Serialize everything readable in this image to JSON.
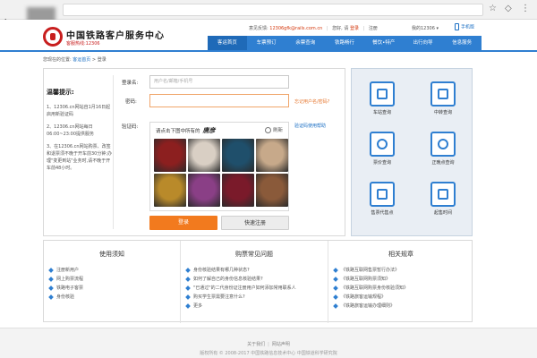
{
  "site": {
    "title": "中国铁路客户服务中心",
    "hotline": "客服热线:12306"
  },
  "toplinks": {
    "email": "12306gfk@rails.com.cn",
    "login_prompt": "您好, 请",
    "login": "登录",
    "register": "注册",
    "user_menu": "我的12306 ▾",
    "mobile": "手机版"
  },
  "nav": {
    "items": [
      "客运首页",
      "车票预订",
      "余票查询",
      "铁路畅行",
      "餐饮•特产",
      "出行向导",
      "信息服务"
    ]
  },
  "breadcrumb": {
    "prefix": "您现在的位置:",
    "home": "客运首页",
    "sep": ">",
    "current": "登录"
  },
  "tips": {
    "title": "温馨提示:",
    "items": [
      "1、12306.cn网站自1月16日起启用新验证码",
      "2、12306.cn网站每日06:00~23:00提供服务",
      "3、在12306.cn网站购票、改签和退票须不晚于开车前30分钟;办理\"变更到站\"业务时,请不晚于开车前48小时。"
    ]
  },
  "login_form": {
    "username_label": "登录名:",
    "username_placeholder": "用户名/邮箱/手机号",
    "password_label": "密码:",
    "password_value": "",
    "forgot_link": "忘记用户名/密码?",
    "captcha_label": "验证码:",
    "captcha_help_link": "验证码使用帮助",
    "captcha_prompt": "请点击下图中所有的",
    "captcha_keyword": "",
    "captcha_handwriting": "唐彦",
    "refresh_label": "刷新",
    "login_button": "登录",
    "register_button": "快速注册"
  },
  "captcha_tiles": [
    {
      "name": "red-roses",
      "color": "#8c1f1f"
    },
    {
      "name": "wall-clock",
      "color": "#d9cfc4"
    },
    {
      "name": "peacock",
      "color": "#1f4f6b"
    },
    {
      "name": "firecracker",
      "color": "#c7a98a"
    },
    {
      "name": "round-mirror",
      "color": "#b98a2a"
    },
    {
      "name": "purple-cabbage",
      "color": "#8a3f86"
    },
    {
      "name": "cherries-bowl",
      "color": "#7a1a2a"
    },
    {
      "name": "pyramid-sunset",
      "color": "#8a5a3a"
    }
  ],
  "services": [
    {
      "label": "车站查询",
      "icon": "station-icon"
    },
    {
      "label": "中转查询",
      "icon": "transfer-icon"
    },
    {
      "label": "票价查询",
      "icon": "fare-icon"
    },
    {
      "label": "正晚点查询",
      "icon": "clock-icon"
    },
    {
      "label": "售票代售点",
      "icon": "agency-icon"
    },
    {
      "label": "起售时间",
      "icon": "calendar-icon"
    }
  ],
  "faq": {
    "col1": {
      "title": "使用须知",
      "items": [
        "注册新用户",
        "网上购票流程",
        "铁路电子客票",
        "身份核验"
      ]
    },
    "col2": {
      "title": "购票常见问题",
      "items": [
        "身份核验结果有哪几种状态?",
        "如何了解自己的身份信息核验结果?",
        "\"已通过\"的二代身份证注册用户如何添加常用联系人",
        "购买学生票需要注意什么?",
        "更多"
      ]
    },
    "col3": {
      "title": "相关规章",
      "items": [
        "《铁路互联网售票暂行办法》",
        "《铁路互联网购票须知》",
        "《铁路互联网购票身份核验须知》",
        "《铁路旅客运输规程》",
        "《铁路旅客运输办理细则》"
      ]
    }
  },
  "footer": {
    "about": "关于我们",
    "sep": "|",
    "statement": "网站声明",
    "copyright": "版权所有 © 2008-2017 中国铁路信息技术中心 中国铁道科学研究院"
  },
  "colors": {
    "brand_blue": "#2f7fd1",
    "brand_red": "#c81e1e",
    "login_orange": "#f27a1e"
  }
}
